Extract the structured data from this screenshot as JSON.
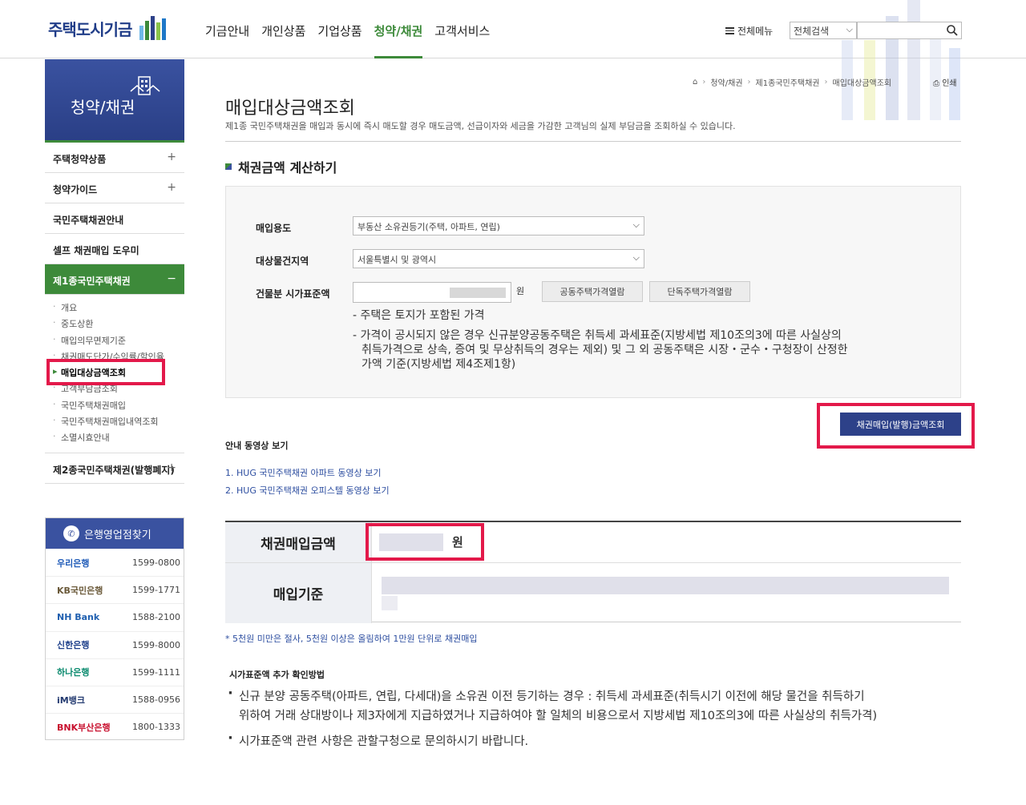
{
  "header": {
    "logo_text": "주택도시기금",
    "gnb": [
      "기금안내",
      "개인상품",
      "기업상품",
      "청약/채권",
      "고객서비스"
    ],
    "all_menu": "전체메뉴",
    "search_select": "전체검색",
    "search_placeholder": ""
  },
  "sidebar": {
    "title": "청약/채권",
    "items": [
      {
        "label": "주택청약상품",
        "toggle": "+"
      },
      {
        "label": "청약가이드",
        "toggle": "+"
      },
      {
        "label": "국민주택채권안내",
        "toggle": ""
      },
      {
        "label": "셀프 채권매입 도우미",
        "toggle": ""
      },
      {
        "label": "제1종국민주택채권",
        "toggle": "−"
      }
    ],
    "sub_items": [
      "개요",
      "중도상환",
      "매입의무면제기준",
      "채권매도단가/수익률/할인율",
      "매입대상금액조회",
      "고객부담금조회",
      "국민주택채권매입",
      "국민주택채권매입내역조회",
      "소멸시효안내"
    ],
    "last_item": {
      "label": "제2종국민주택채권(발행폐지)",
      "toggle": "+"
    },
    "bank": {
      "title": "은행영업점찾기",
      "rows": [
        {
          "name": "우리은행",
          "number": "1599-0800",
          "color": "#1f5bb8"
        },
        {
          "name": "KB국민은행",
          "number": "1599-1771",
          "color": "#6b5a3a"
        },
        {
          "name": "NH Bank",
          "number": "1588-2100",
          "color": "#2060b0"
        },
        {
          "name": "신한은행",
          "number": "1599-8000",
          "color": "#1d3f8a"
        },
        {
          "name": "하나은행",
          "number": "1599-1111",
          "color": "#0a8a6e"
        },
        {
          "name": "iM뱅크",
          "number": "1588-0956",
          "color": "#233a70"
        },
        {
          "name": "BNK부산은행",
          "number": "1800-1333",
          "color": "#c8102e"
        }
      ]
    }
  },
  "breadcrumb": [
    "청약/채권",
    "제1종국민주택채권",
    "매입대상금액조회"
  ],
  "print_label": "인쇄",
  "page": {
    "title": "매입대상금액조회",
    "desc": "제1종 국민주택채권을 매입과 동시에 즉시 매도할 경우 매도금액, 선급이자와 세금을 가감한 고객님의 실제 부담금을 조회하실 수 있습니다.",
    "section_title": "채권금액 계산하기"
  },
  "form": {
    "purpose_label": "매입용도",
    "purpose_value": "부동산 소유권등기(주택, 아파트, 연립)",
    "region_label": "대상물건지역",
    "region_value": "서울특별시 및 광역시",
    "price_label": "건물분 시가표준액",
    "won": "원",
    "btn_apt": "공동주택가격열람",
    "btn_house": "단독주택가격열람",
    "note1": "- 주택은 토지가 포함된 가격",
    "note2a": "- 가격이 공시되지 않은 경우 신규분양공동주택은 취득세 과세표준(지방세법 제10조의3에 따른 사실상의",
    "note2b": "취득가격으로 상속, 증여 및 무상취득의 경우는 제외) 및 그 외 공동주택은 시장・군수・구청장이 산정한",
    "note2c": "가액 기준(지방세법 제4조제1항)"
  },
  "main_button": "채권매입(발행)금액조회",
  "video": {
    "title": "안내 동영상 보기",
    "links": [
      "1. HUG 국민주택채권 아파트 동영상 보기",
      "2. HUG 국민주택채권 오피스텔 동영상 보기"
    ]
  },
  "result": {
    "amount_label": "채권매입금액",
    "amount_unit": "원",
    "basis_label": "매입기준"
  },
  "footnote": "* 5천원 미만은 절사, 5천원 이상은 올림하여 1만원 단위로 채권매입",
  "info": {
    "title": "시가표준액 추가 확인방법",
    "item1a": "신규 분양 공동주택(아파트, 연립, 다세대)을 소유권 이전 등기하는 경우 : 취득세 과세표준(취득시기 이전에 해당 물건을 취득하기",
    "item1b": "위하여 거래 상대방이나 제3자에게 지급하였거나 지급하여야 할 일체의 비용으로서 지방세법 제10조의3에 따른 사실상의 취득가격)",
    "item2": "시가표준액 관련 사항은 관할구청으로 문의하시기 바랍니다."
  },
  "colors": {
    "brand_blue": "#2d4189",
    "brand_green": "#3d8a3a",
    "highlight": "#e3194a"
  }
}
